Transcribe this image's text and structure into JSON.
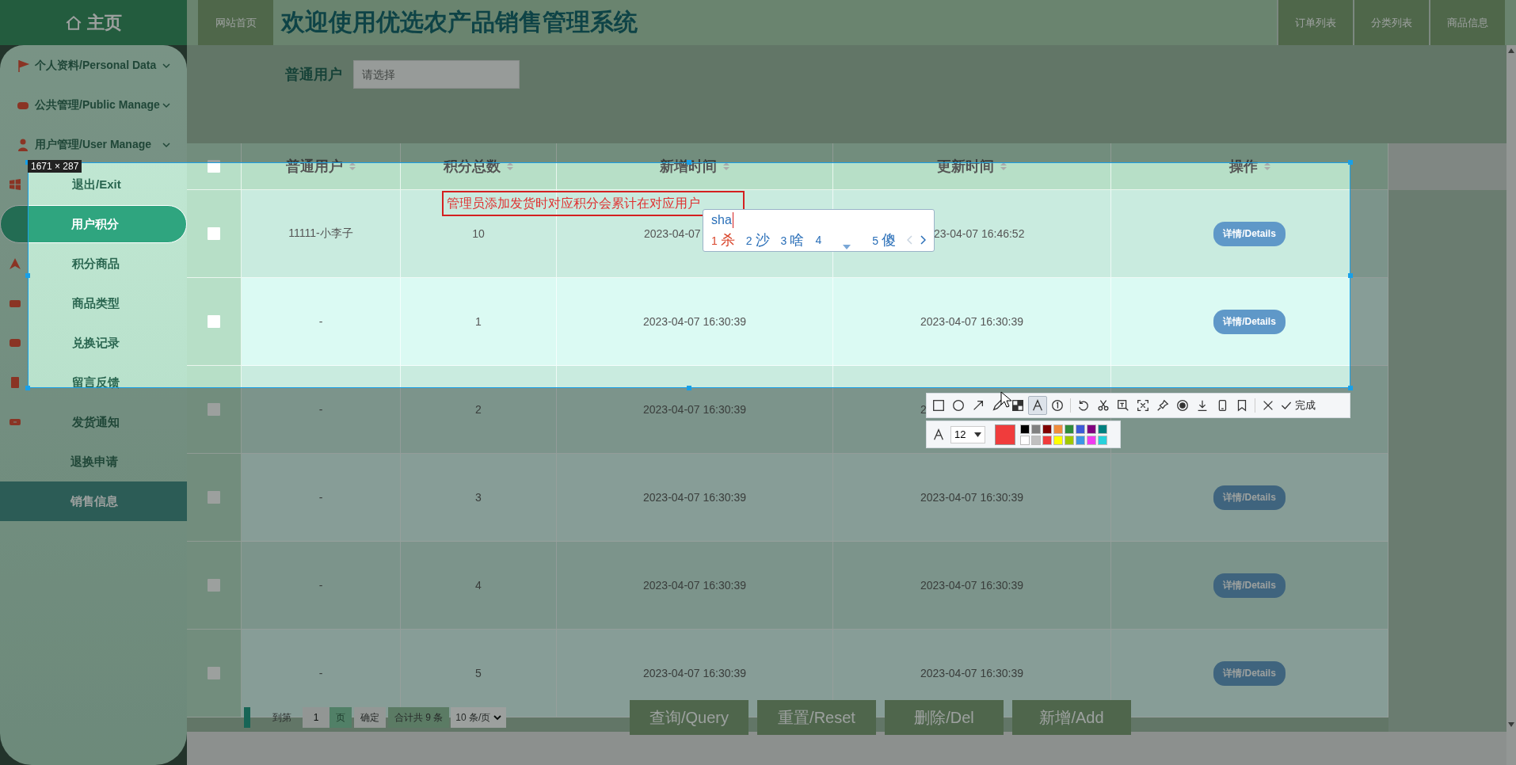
{
  "header": {
    "logo": "主页",
    "home_link": "网站首页",
    "title": "欢迎使用优选农产品销售管理系统",
    "nav": [
      {
        "label": "订单列表"
      },
      {
        "label": "分类列表"
      },
      {
        "label": "商品信息"
      }
    ]
  },
  "sidebar": {
    "items": [
      {
        "label": "个人资料/Personal Data",
        "kind": "menu",
        "selected": false,
        "highlighted": false
      },
      {
        "label": "公共管理/Public Manage",
        "kind": "menu",
        "selected": false,
        "highlighted": false
      },
      {
        "label": "用户管理/User Manage",
        "kind": "menu",
        "selected": false,
        "highlighted": false
      },
      {
        "label": "退出/Exit",
        "kind": "sub",
        "selected": false,
        "highlighted": false
      },
      {
        "label": "用户积分",
        "kind": "sub",
        "selected": true,
        "highlighted": false
      },
      {
        "label": "积分商品",
        "kind": "sub",
        "selected": false,
        "highlighted": false
      },
      {
        "label": "商品类型",
        "kind": "sub",
        "selected": false,
        "highlighted": false
      },
      {
        "label": "兑换记录",
        "kind": "sub",
        "selected": false,
        "highlighted": false
      },
      {
        "label": "留言反馈",
        "kind": "sub",
        "selected": false,
        "highlighted": false
      },
      {
        "label": "发货通知",
        "kind": "sub",
        "selected": false,
        "highlighted": false
      },
      {
        "label": "退换申请",
        "kind": "sub",
        "selected": false,
        "highlighted": false
      },
      {
        "label": "销售信息",
        "kind": "sub",
        "selected": false,
        "highlighted": true
      }
    ]
  },
  "filter": {
    "label": "普通用户",
    "placeholder": "请选择"
  },
  "table": {
    "all_checked": false,
    "columns": [
      {
        "label": "普通用户",
        "sortable": true
      },
      {
        "label": "积分总数",
        "sortable": true
      },
      {
        "label": "新增时间",
        "sortable": true
      },
      {
        "label": "更新时间",
        "sortable": true
      },
      {
        "label": "操作",
        "sortable": true
      }
    ],
    "rows": [
      {
        "checked": false,
        "user": "11111-小李子",
        "points": "10",
        "created": "2023-04-07",
        "updated": "23-04-07 16:46:52",
        "action": "详情/Details"
      },
      {
        "checked": false,
        "user": "-",
        "points": "1",
        "created": "2023-04-07 16:30:39",
        "updated": "2023-04-07 16:30:39",
        "action": "详情/Details"
      },
      {
        "checked": false,
        "user": "-",
        "points": "2",
        "created": "2023-04-07 16:30:39",
        "updated": "2"
      },
      {
        "checked": false,
        "user": "-",
        "points": "3",
        "created": "2023-04-07 16:30:39",
        "updated": "2023-04-07 16:30:39",
        "action": "详情/Details"
      },
      {
        "checked": false,
        "user": "-",
        "points": "4",
        "created": "2023-04-07 16:30:39",
        "updated": "2023-04-07 16:30:39",
        "action": "详情/Details"
      },
      {
        "checked": false,
        "user": "-",
        "points": "5",
        "created": "2023-04-07 16:30:39",
        "updated": "2023-04-07 16:30:39",
        "action": "详情/Details"
      }
    ]
  },
  "pagination": {
    "goto": "到第",
    "page": "1",
    "unit": "页",
    "confirm": "确定",
    "total": "合计共 9 条",
    "page_size": "10 条/页"
  },
  "actions": [
    "查询/Query",
    "重置/Reset",
    "删除/Del",
    "新增/Add"
  ],
  "capture": {
    "size": "1671 × 287",
    "annotation": "管理员添加发货时对应积分会累计在对应用户",
    "ime": {
      "input": "sha",
      "candidates": [
        {
          "index": "1",
          "text": "杀",
          "selected": true
        },
        {
          "index": "2",
          "text": "沙",
          "selected": false
        },
        {
          "index": "3",
          "text": "啥",
          "selected": false
        },
        {
          "index": "4",
          "selected": false
        },
        {
          "index": "5",
          "text": "傻",
          "selected": false
        }
      ]
    },
    "tools": [
      {
        "kind": "rectangle",
        "selected": false
      },
      {
        "kind": "ellipse",
        "selected": false
      },
      {
        "kind": "arrow",
        "selected": false
      },
      {
        "kind": "pen",
        "selected": false
      },
      {
        "kind": "mosaic",
        "selected": false
      },
      {
        "kind": "text",
        "selected": true
      },
      {
        "kind": "number",
        "selected": false
      },
      {
        "kind": "undo",
        "selected": false
      },
      {
        "kind": "cut",
        "selected": false
      },
      {
        "kind": "ocr",
        "selected": false
      },
      {
        "kind": "expand",
        "selected": false
      },
      {
        "kind": "pin",
        "selected": false
      },
      {
        "kind": "record",
        "selected": false
      },
      {
        "kind": "save",
        "selected": false
      },
      {
        "kind": "phone",
        "selected": false
      },
      {
        "kind": "bookmark",
        "selected": false
      },
      {
        "kind": "close",
        "selected": false
      }
    ],
    "done": "完成",
    "font_size": "12",
    "current_color": {
      "color": "#f03c3c"
    },
    "palette": [
      {
        "color": "#000000"
      },
      {
        "color": "#808080"
      },
      {
        "color": "#800000"
      },
      {
        "color": "#f08c3c"
      },
      {
        "color": "#2e8b3c"
      },
      {
        "color": "#3c5ad8"
      },
      {
        "color": "#800080"
      },
      {
        "color": "#008080"
      },
      {
        "color": "#ffffff"
      },
      {
        "color": "#c0c0c0"
      },
      {
        "color": "#f03c3c"
      },
      {
        "color": "#ffff00"
      },
      {
        "color": "#a0c800"
      },
      {
        "color": "#3c96e6"
      },
      {
        "color": "#f03cf0"
      },
      {
        "color": "#28d2dc"
      }
    ]
  }
}
